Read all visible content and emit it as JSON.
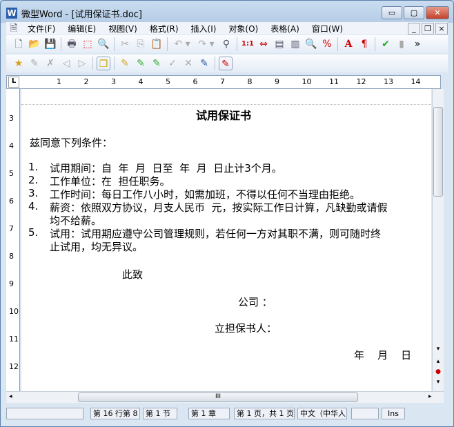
{
  "window": {
    "title": "微型Word - [试用保证书.doc]",
    "minimize": "▭",
    "maximize": "▢",
    "close": "✕"
  },
  "menu": [
    "文件(F)",
    "编辑(E)",
    "视图(V)",
    "格式(R)",
    "插入(I)",
    "对象(O)",
    "表格(A)",
    "窗口(W)"
  ],
  "toolbar1": [
    "new-icon",
    "open-icon",
    "save-icon",
    "print-icon",
    "pdf-icon",
    "preview-icon",
    "cut-icon",
    "copy-icon",
    "paste-icon",
    "undo-icon",
    "redo-icon",
    "find-icon",
    "actual-size-icon",
    "page-width-icon",
    "single-page-icon",
    "two-page-icon",
    "zoom-icon",
    "zoom-percent-icon",
    "font-color-icon",
    "paragraph-icon",
    "spellcheck-icon",
    "chart-icon"
  ],
  "toolbar2": [
    "new-comment-icon",
    "edit-comment-icon",
    "delete-comment-icon",
    "prev-comment-icon",
    "next-comment-icon",
    "show-comments-icon",
    "highlight-icon",
    "prev-revision-icon",
    "next-revision-icon",
    "accept-icon",
    "reject-icon",
    "track-changes-icon",
    "review-pane-icon"
  ],
  "more": "»",
  "ruler": {
    "marks": [
      "1",
      "2",
      "3",
      "4",
      "5",
      "6",
      "7",
      "8",
      "9",
      "10",
      "11",
      "12",
      "13",
      "14"
    ],
    "vmarks": [
      "3",
      "4",
      "5",
      "6",
      "7",
      "8",
      "9",
      "10",
      "11",
      "12"
    ]
  },
  "document": {
    "title": "试用保证书",
    "intro": "兹同意下列条件：",
    "items": [
      {
        "num": "1.",
        "lines": [
          "试用期间：自  年  月  日至  年  月  日止计3个月。"
        ]
      },
      {
        "num": "2.",
        "lines": [
          "工作单位：在  担任职务。"
        ]
      },
      {
        "num": "3.",
        "lines": [
          "工作时间：每日工作八小时，如需加班，不得以任何不当理由拒绝。"
        ]
      },
      {
        "num": "4.",
        "lines": [
          "薪资：依照双方协议，月支人民币  元，按实际工作日计算，凡缺勤或请假",
          "均不给薪。"
        ]
      },
      {
        "num": "5.",
        "lines": [
          "试用：试用期应遵守公司管理规则，若任何一方对其职不满，则可随时终",
          "止试用，均无异议。"
        ]
      }
    ],
    "closing": "此致",
    "company": "公司  ：",
    "guarantor": "立担保书人：",
    "date": "年    月    日"
  },
  "status": [
    "",
    "第 16 行第 8",
    "第 1 节",
    "第 1 章",
    "第 1 页，共 1 页",
    "中文（中华人",
    "",
    "Ins"
  ]
}
